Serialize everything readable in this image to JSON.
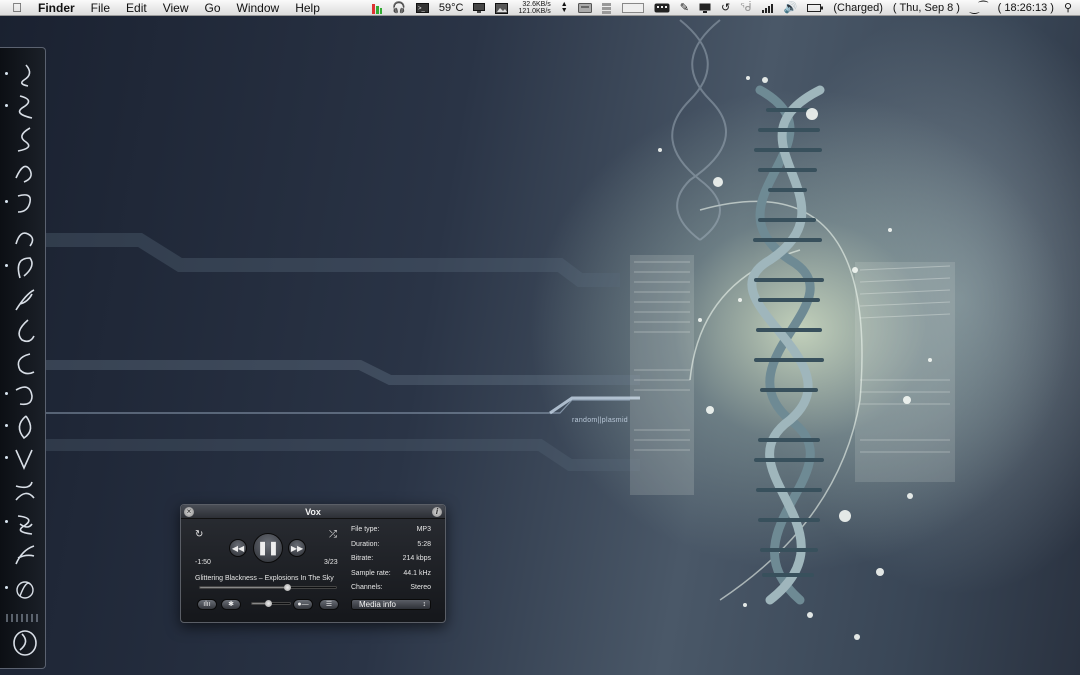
{
  "menubar": {
    "apple_icon": "apple-logo-icon",
    "items": [
      "Finder",
      "File",
      "Edit",
      "View",
      "Go",
      "Window",
      "Help"
    ],
    "temperature": "59°C",
    "net_up": "32.6KB/s",
    "net_down": "121.0KB/s",
    "battery_status": "(Charged)",
    "date": "( Thu, Sep 8 )",
    "time": "( 18:26:13 )",
    "icons": [
      "cpu-meter-icon",
      "headphones-icon",
      "terminal-icon",
      "temperature-icon",
      "display-icon",
      "network-arrows-icon",
      "disk-icon",
      "battery-bars-icon",
      "keyboard-icon",
      "pen-icon",
      "monitor-icon",
      "time-machine-icon",
      "bluetooth-icon",
      "wifi-icon",
      "volume-icon",
      "battery-icon",
      "spotlight-icon"
    ]
  },
  "wallpaper": {
    "text": "random||plasmid"
  },
  "dock": {
    "items": 18,
    "icons": [
      "swirl-icon"
    ]
  },
  "vox": {
    "title": "Vox",
    "elapsed": "-1:50",
    "track_position": "3/23",
    "track_title": "Glittering Blackness – Explosions In The Sky",
    "progress": 0.64,
    "volume": 0.42,
    "info": [
      {
        "label": "File type:",
        "value": "MP3"
      },
      {
        "label": "Duration:",
        "value": "5:28"
      },
      {
        "label": "Bitrate:",
        "value": "214 kbps"
      },
      {
        "label": "Sample rate:",
        "value": "44.1 kHz"
      },
      {
        "label": "Channels:",
        "value": "Stereo"
      }
    ],
    "info_select": "Media info",
    "buttons": {
      "repeat": "repeat-icon",
      "shuffle": "shuffle-icon",
      "previous": "rewind-icon",
      "play_pause": "pause-icon",
      "next": "fast-forward-icon"
    }
  }
}
